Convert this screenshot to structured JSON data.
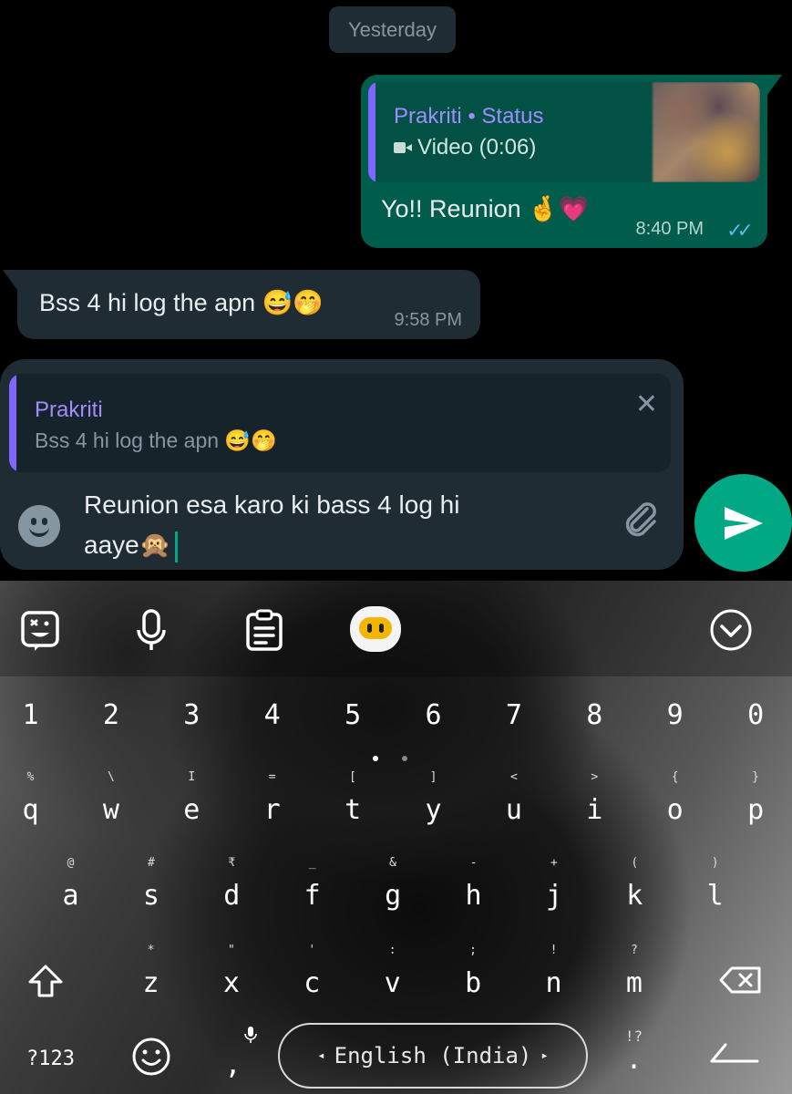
{
  "chat": {
    "date_chip": "Yesterday",
    "outgoing": {
      "quote_name": "Prakriti • Status",
      "quote_media": "Video (0:06)",
      "text": "Yo!! Reunion 🤞💗",
      "time": "8:40 PM",
      "ticks": "✓✓"
    },
    "incoming": {
      "text": "Bss 4 hi log the apn 😅🤭",
      "time": "9:58 PM"
    }
  },
  "compose": {
    "reply_name": "Prakriti",
    "reply_text": "Bss 4 hi log the apn 😅🤭",
    "close_glyph": "✕",
    "input_value": "Reunion esa karo ki bass 4 log hi\naaye🙊",
    "icons": {
      "emoji": "emoji-icon",
      "attach": "paperclip-icon",
      "send": "send-icon"
    }
  },
  "keyboard": {
    "numbers": [
      "1",
      "2",
      "3",
      "4",
      "5",
      "6",
      "7",
      "8",
      "9",
      "0"
    ],
    "row1": {
      "keys": [
        "q",
        "w",
        "e",
        "r",
        "t",
        "y",
        "u",
        "i",
        "o",
        "p"
      ],
      "subs": [
        "%",
        "\\",
        "I",
        "=",
        "[",
        "]",
        "<",
        ">",
        "{",
        "}"
      ]
    },
    "row2": {
      "keys": [
        "a",
        "s",
        "d",
        "f",
        "g",
        "h",
        "j",
        "k",
        "l"
      ],
      "subs": [
        "@",
        "#",
        "₹",
        "_",
        "&",
        "-",
        "+",
        "(",
        ")"
      ]
    },
    "row3": {
      "keys": [
        "z",
        "x",
        "c",
        "v",
        "b",
        "n",
        "m"
      ],
      "subs": [
        "*",
        "\"",
        "'",
        ":",
        ";",
        "!",
        "?"
      ]
    },
    "symbols_key": "?123",
    "comma_key": ",",
    "period_key": ".",
    "period_sub": "!?",
    "space_label": "English (India)",
    "space_left_arrow": "◂",
    "space_right_arrow": "▸",
    "colors": {
      "accent": "#00a884",
      "bubble_out": "#005c4b",
      "bubble_in": "#1f2c34"
    }
  }
}
